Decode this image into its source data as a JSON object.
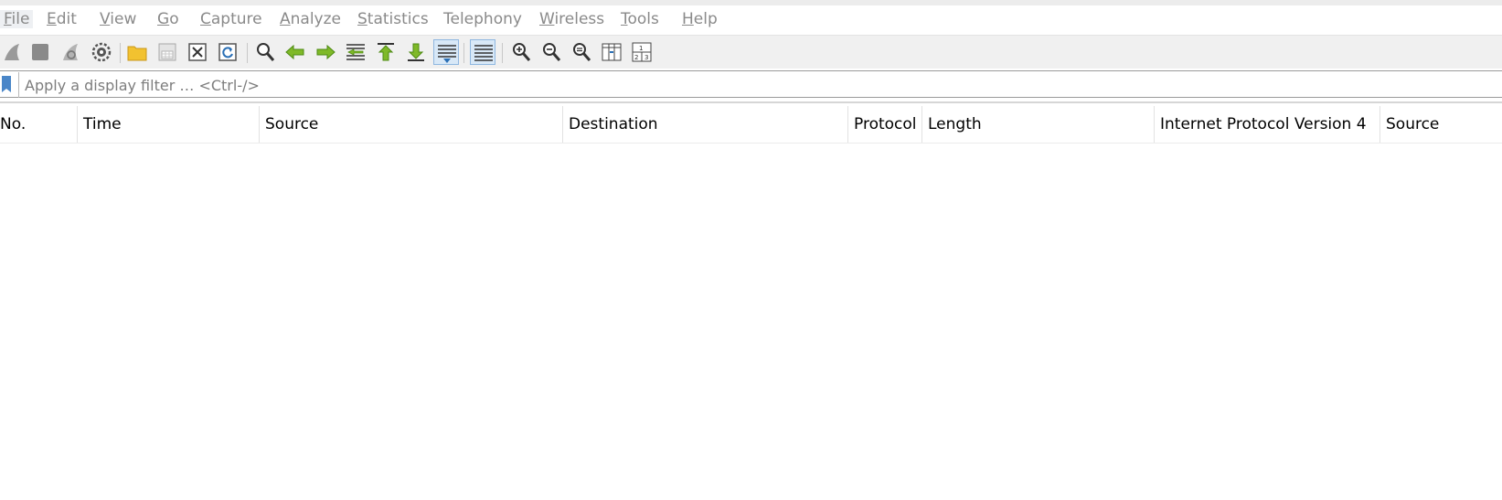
{
  "menubar": {
    "items": [
      {
        "label": "File",
        "acc": "F",
        "rest": "ile"
      },
      {
        "label": "Edit",
        "acc": "E",
        "rest": "dit"
      },
      {
        "label": "View",
        "acc": "V",
        "rest": "iew"
      },
      {
        "label": "Go",
        "acc": "G",
        "rest": "o"
      },
      {
        "label": "Capture",
        "acc": "C",
        "rest": "apture"
      },
      {
        "label": "Analyze",
        "acc": "A",
        "rest": "nalyze"
      },
      {
        "label": "Statistics",
        "acc": "S",
        "rest": "tatistics"
      },
      {
        "label": "Telephony",
        "acc": "",
        "rest": "Telephony"
      },
      {
        "label": "Wireless",
        "acc": "W",
        "rest": "ireless"
      },
      {
        "label": "Tools",
        "acc": "T",
        "rest": "ools"
      },
      {
        "label": "Help",
        "acc": "H",
        "rest": "elp"
      }
    ]
  },
  "toolbar": {
    "buttons": [
      {
        "icon": "start-capture-fin-icon",
        "pressed": false
      },
      {
        "icon": "stop-capture-icon",
        "pressed": false
      },
      {
        "icon": "restart-capture-fin-icon",
        "pressed": false
      },
      {
        "icon": "capture-options-gear-icon",
        "pressed": false
      },
      {
        "icon": "open-folder-icon",
        "pressed": false
      },
      {
        "icon": "save-file-icon",
        "pressed": false
      },
      {
        "icon": "close-file-icon",
        "pressed": false
      },
      {
        "icon": "reload-file-icon",
        "pressed": false
      },
      {
        "icon": "find-packet-icon",
        "pressed": false
      },
      {
        "icon": "go-back-arrow-icon",
        "pressed": false
      },
      {
        "icon": "go-forward-arrow-icon",
        "pressed": false
      },
      {
        "icon": "go-to-packet-icon",
        "pressed": false
      },
      {
        "icon": "go-first-packet-icon",
        "pressed": false
      },
      {
        "icon": "go-last-packet-icon",
        "pressed": false
      },
      {
        "icon": "autoscroll-icon",
        "pressed": true
      },
      {
        "icon": "colorize-list-icon",
        "pressed": true
      },
      {
        "icon": "zoom-in-icon",
        "pressed": false
      },
      {
        "icon": "zoom-out-icon",
        "pressed": false
      },
      {
        "icon": "zoom-normal-icon",
        "pressed": false
      },
      {
        "icon": "resize-columns-icon",
        "pressed": false
      },
      {
        "icon": "layout-panes-icon",
        "pressed": false
      }
    ]
  },
  "filter": {
    "placeholder": "Apply a display filter … <Ctrl-/>",
    "value": "",
    "bookmark_icon": "filter-bookmark-icon"
  },
  "packet_list": {
    "columns": [
      "No.",
      "Time",
      "Source",
      "Destination",
      "Protocol",
      "Length",
      "Internet Protocol Version 4",
      "Source"
    ],
    "rows": []
  },
  "colors": {
    "accent": "#4a86c8",
    "menu_text": "#8a8a8a",
    "toolbar_bg": "#f0f0f0",
    "pressed_bg": "#d8e8f7"
  }
}
